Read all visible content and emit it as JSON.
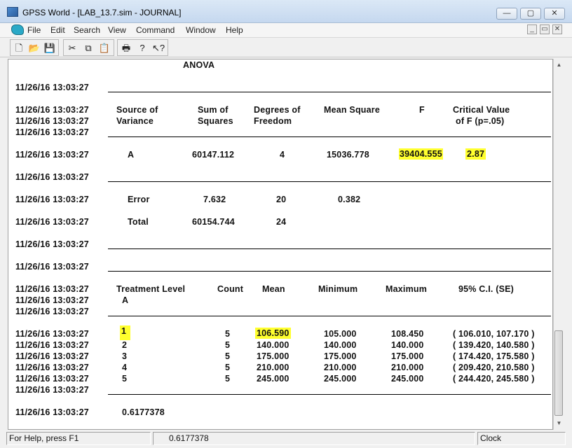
{
  "window": {
    "title": "GPSS World - [LAB_13.7.sim  -  JOURNAL]",
    "minimize": "—",
    "maximize": "▢",
    "close": "✕"
  },
  "menu": {
    "items": [
      "File",
      "Edit",
      "Search",
      "View",
      "Command",
      "Window",
      "Help"
    ],
    "mdi_minimize": "_",
    "mdi_restore": "▭",
    "mdi_close": "✕"
  },
  "toolbar": {
    "buttons": [
      {
        "name": "new-icon",
        "glyph": "🗋"
      },
      {
        "name": "open-icon",
        "glyph": "📂"
      },
      {
        "name": "save-icon",
        "glyph": "💾"
      },
      {
        "name": "cut-icon",
        "glyph": "✂"
      },
      {
        "name": "copy-icon",
        "glyph": "⧉"
      },
      {
        "name": "paste-icon",
        "glyph": "📋"
      },
      {
        "name": "print-icon",
        "glyph": "🖶"
      },
      {
        "name": "help-icon",
        "glyph": "?"
      },
      {
        "name": "context-help-icon",
        "glyph": "↖?"
      }
    ]
  },
  "journal": {
    "timestamp": "11/26/16 13:03:27",
    "anova_title": "ANOVA",
    "anova_headers": {
      "source": [
        "Source of",
        "Variance"
      ],
      "sum_sq": [
        "Sum of",
        "Squares"
      ],
      "df": [
        "Degrees of",
        "Freedom"
      ],
      "mean_sq": "Mean Square",
      "f": "F",
      "crit": [
        "Critical Value",
        "of F (p=.05)"
      ]
    },
    "anova_rows": [
      {
        "source": "A",
        "sum_sq": "60147.112",
        "df": "4",
        "mean_sq": "15036.778",
        "f": "39404.555",
        "crit": "2.87"
      },
      {
        "source": "Error",
        "sum_sq": "7.632",
        "df": "20",
        "mean_sq": "0.382",
        "f": "",
        "crit": ""
      },
      {
        "source": "Total",
        "sum_sq": "60154.744",
        "df": "24",
        "mean_sq": "",
        "f": "",
        "crit": ""
      }
    ],
    "treat_headers": {
      "level": [
        "Treatment Level",
        "A"
      ],
      "count": "Count",
      "mean": "Mean",
      "min": "Minimum",
      "max": "Maximum",
      "ci": "95% C.I. (SE)"
    },
    "treat_rows": [
      {
        "level": "1",
        "count": "5",
        "mean": "106.590",
        "min": "105.000",
        "max": "108.450",
        "ci": "( 106.010, 107.170 )"
      },
      {
        "level": "2",
        "count": "5",
        "mean": "140.000",
        "min": "140.000",
        "max": "140.000",
        "ci": "( 139.420, 140.580 )"
      },
      {
        "level": "3",
        "count": "5",
        "mean": "175.000",
        "min": "175.000",
        "max": "175.000",
        "ci": "( 174.420, 175.580 )"
      },
      {
        "level": "4",
        "count": "5",
        "mean": "210.000",
        "min": "210.000",
        "max": "210.000",
        "ci": "( 209.420, 210.580 )"
      },
      {
        "level": "5",
        "count": "5",
        "mean": "245.000",
        "min": "245.000",
        "max": "245.000",
        "ci": "( 244.420, 245.580 )"
      }
    ],
    "final_value": "0.6177378"
  },
  "status": {
    "help": "For Help, press F1",
    "value": "0.6177378",
    "clock": "Clock"
  },
  "colors": {
    "highlight": "#ffff2e",
    "titlebar": "#c5d8ef"
  }
}
